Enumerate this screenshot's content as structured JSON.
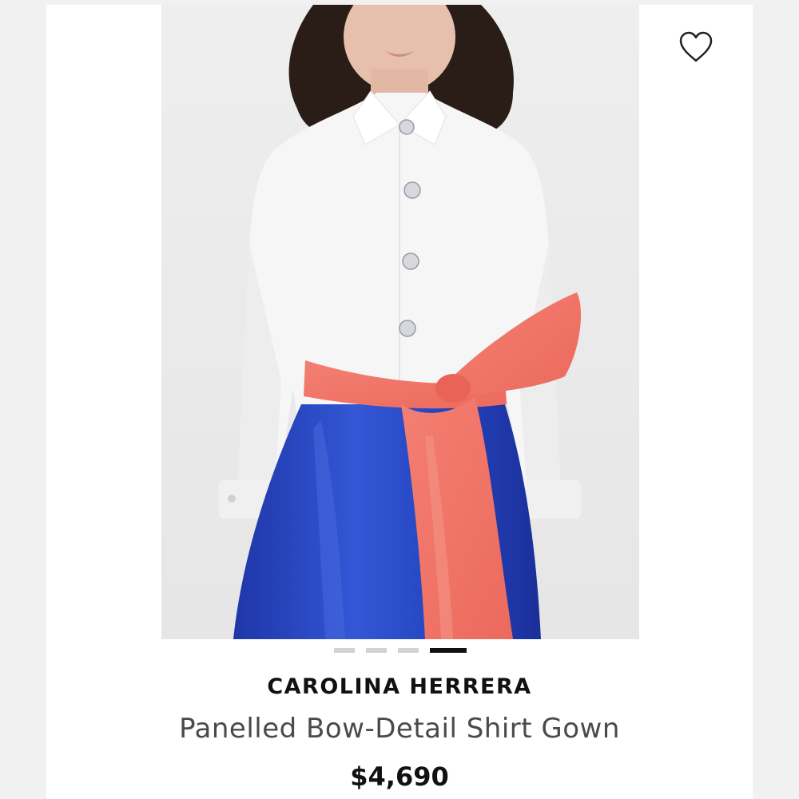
{
  "product": {
    "brand": "CAROLINA HERRERA",
    "title": "Panelled Bow-Detail Shirt Gown",
    "price": "$4,690"
  },
  "gallery": {
    "image_count": 4,
    "active_index": 4,
    "image_subject": "model-wearing-shirt-gown"
  },
  "icons": {
    "wishlist": "heart-outline-icon"
  },
  "colors": {
    "shirt": "#f7f6f6",
    "skirt": "#2a47c4",
    "sash": "#f2786a",
    "active_dot": "#111111",
    "inactive_dot": "#d3d3d3"
  }
}
